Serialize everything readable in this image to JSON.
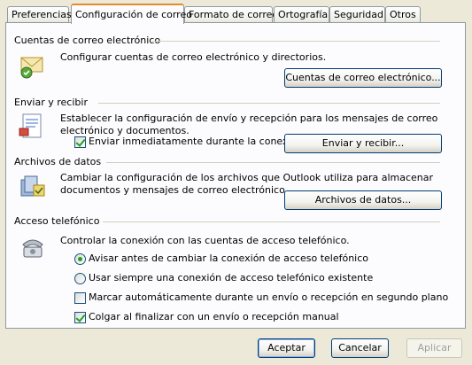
{
  "tabs": [
    {
      "label": "Preferencias"
    },
    {
      "label": "Configuración de correo"
    },
    {
      "label": "Formato de correo"
    },
    {
      "label": "Ortografía"
    },
    {
      "label": "Seguridad"
    },
    {
      "label": "Otros"
    }
  ],
  "active_tab": "Configuración de correo",
  "sections": {
    "accounts": {
      "title": "Cuentas de correo electrónico",
      "description": "Configurar cuentas de correo electrónico y directorios.",
      "button": "Cuentas de correo electrónico..."
    },
    "sendreceive": {
      "title": "Enviar y recibir",
      "description": "Establecer la configuración de envío y recepción para los mensajes de correo electrónico y documentos.",
      "checkbox": "Enviar inmediatamente durante la conexión",
      "checkbox_checked": true,
      "button": "Enviar y recibir..."
    },
    "datafiles": {
      "title": "Archivos de datos",
      "description": "Cambiar la configuración de los archivos que Outlook utiliza para almacenar documentos y mensajes de correo electrónico.",
      "button": "Archivos de datos..."
    },
    "dialup": {
      "title": "Acceso telefónico",
      "description": "Controlar la conexión con las cuentas de acceso telefónico.",
      "radio1": "Avisar antes de cambiar la conexión de acceso telefónico",
      "radio1_selected": true,
      "radio2": "Usar siempre una conexión de acceso telefónico existente",
      "radio2_selected": false,
      "check1": "Marcar automáticamente durante un envío o recepción en segundo plano",
      "check1_checked": false,
      "check2": "Colgar al finalizar con un envío o recepción manual",
      "check2_checked": true
    }
  },
  "footer": {
    "ok": "Aceptar",
    "cancel": "Cancelar",
    "apply": "Aplicar",
    "apply_enabled": false
  },
  "icons": {
    "accounts": "mail-accounts-icon",
    "sendreceive": "send-receive-icon",
    "datafiles": "data-files-icon",
    "dialup": "telephone-icon"
  },
  "colors": {
    "dialog_bg": "#ece9d8",
    "panel_bg": "#fcfcfe",
    "active_tab_accent": "#e68b2c",
    "button_border": "#003c74",
    "check_mark": "#21a121"
  }
}
